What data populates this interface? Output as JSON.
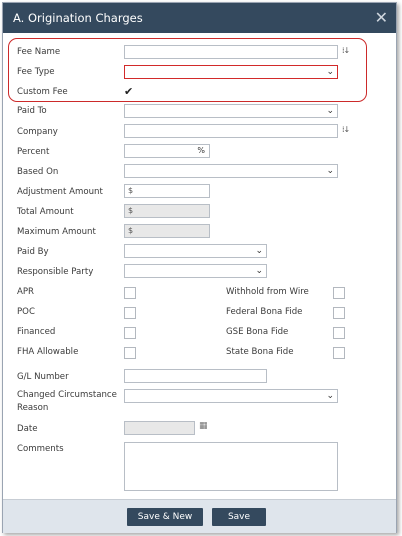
{
  "dialog": {
    "title": "A. Origination Charges",
    "close_glyph": "✕"
  },
  "fields": {
    "fee_name": "Fee Name",
    "fee_type": "Fee Type",
    "custom_fee": "Custom Fee",
    "paid_to": "Paid To",
    "company": "Company",
    "percent": "Percent",
    "percent_suffix": "%",
    "based_on": "Based On",
    "adjustment_amount": "Adjustment Amount",
    "adjustment_prefix": "$",
    "total_amount": "Total Amount",
    "total_prefix": "$",
    "maximum_amount": "Maximum Amount",
    "maximum_prefix": "$",
    "paid_by": "Paid By",
    "responsible_party": "Responsible Party",
    "apr": "APR",
    "poc": "POC",
    "financed": "Financed",
    "fha_allowable": "FHA Allowable",
    "withhold_from_wire": "Withhold from Wire",
    "federal_bona_fide": "Federal Bona Fide",
    "gse_bona_fide": "GSE Bona Fide",
    "state_bona_fide": "State Bona Fide",
    "gl_number": "G/L Number",
    "changed_circumstance_line1": "Changed Circumstance",
    "changed_circumstance_line2": "Reason",
    "date": "Date",
    "comments": "Comments"
  },
  "state": {
    "custom_fee_checked": true
  },
  "icons": {
    "sort": "sort-icon",
    "calendar": "calendar-icon",
    "chevron": "chevron-down-icon"
  },
  "buttons": {
    "save_new": "Save & New",
    "save": "Save"
  },
  "colors": {
    "titlebar": "#34495e",
    "error": "#cc2a2a",
    "footer": "#dfe5ec"
  }
}
